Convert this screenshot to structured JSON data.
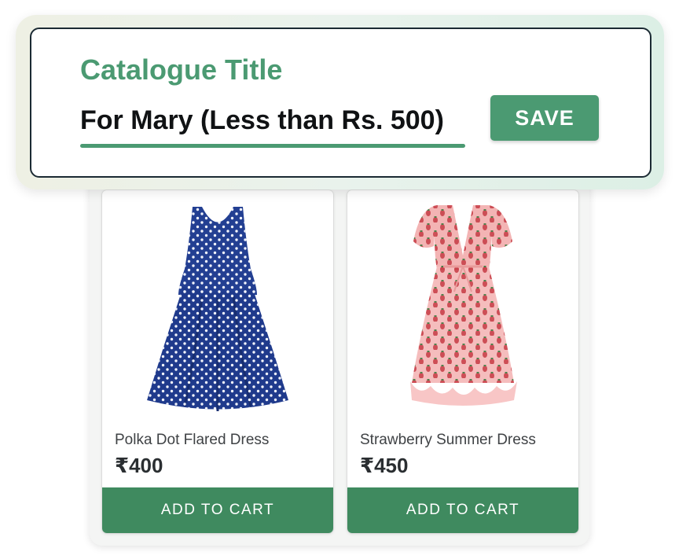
{
  "catalogue": {
    "label": "Catalogue Title",
    "title_value": "For Mary (Less than Rs. 500)",
    "save_label": "SAVE"
  },
  "products": [
    {
      "name": "Polka Dot Flared Dress",
      "currency": "₹",
      "price": "400",
      "add_to_cart_label": "ADD TO CART",
      "image_icon": "navy-polka-dot-dress-image"
    },
    {
      "name": "Strawberry Summer Dress",
      "currency": "₹",
      "price": "450",
      "add_to_cart_label": "ADD TO CART",
      "image_icon": "pink-strawberry-dress-image"
    }
  ],
  "colors": {
    "accent_green": "#4b9a72",
    "cart_green": "#3f8a5f",
    "card_border": "#1b2a33"
  }
}
